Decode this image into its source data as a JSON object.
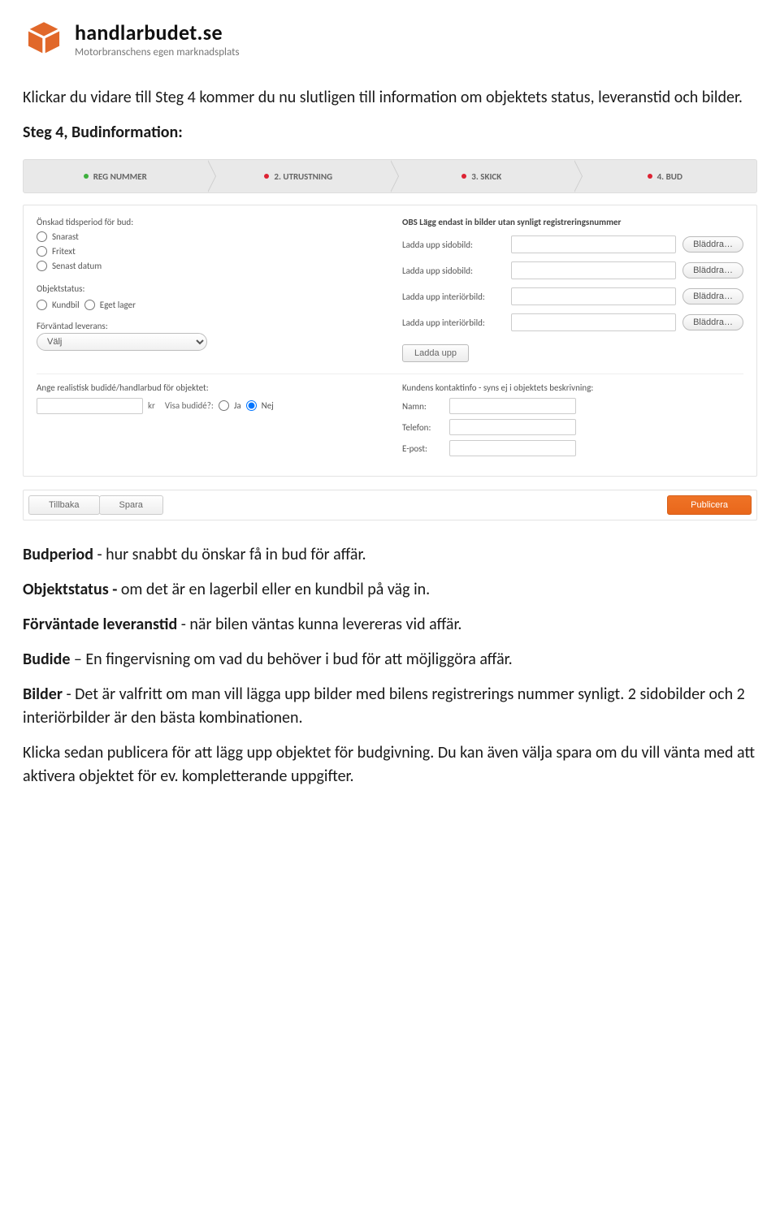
{
  "brand": {
    "title": "handlarbudet.se",
    "subtitle": "Motorbranschens egen marknadsplats"
  },
  "intro": {
    "p1": "Klickar du vidare till Steg 4 kommer du nu slutligen till information om objektets status, leveranstid och bilder.",
    "heading": "Steg 4, Budinformation:"
  },
  "stepper": {
    "s1": "REG NUMMER",
    "s2": "2. UTRUSTNING",
    "s3": "3. SKICK",
    "s4": "4. BUD"
  },
  "form": {
    "period_label": "Önskad tidsperiod för bud:",
    "period_options": {
      "snarast": "Snarast",
      "fritext": "Fritext",
      "senast": "Senast datum"
    },
    "status_label": "Objektstatus:",
    "status_options": {
      "kundbil": "Kundbil",
      "eget": "Eget lager"
    },
    "expected_label": "Förväntad leverans:",
    "expected_value": "Välj",
    "bidide_label": "Ange realistisk budidé/handlarbud för objektet:",
    "kr": "kr",
    "show_label": "Visa budidé?:",
    "yes": "Ja",
    "no": "Nej",
    "upload_notice": "OBS Lägg endast in bilder utan synligt registreringsnummer",
    "upload_side": "Ladda upp sidobild:",
    "upload_interior": "Ladda upp interiörbild:",
    "browse": "Bläddra…",
    "upload_btn": "Ladda upp",
    "contact_header": "Kundens kontaktinfo - syns ej i objektets beskrivning:",
    "contact_name": "Namn:",
    "contact_phone": "Telefon:",
    "contact_email": "E-post:"
  },
  "footer": {
    "back": "Tillbaka",
    "save": "Spara",
    "publish": "Publicera"
  },
  "explain": {
    "l1b": "Budperiod",
    "l1": " - hur snabbt du önskar få in bud för affär.",
    "l2b": "Objektstatus - ",
    "l2": "om det är en lagerbil eller en kundbil på väg in.",
    "l3b": "Förväntade leveranstid",
    "l3": " - när bilen väntas kunna levereras vid affär.",
    "l4b": "Budide",
    "l4": " – En fingervisning om vad du behöver i bud för att möjliggöra affär.",
    "l5b": "Bilder",
    "l5": " - Det är valfritt om man vill lägga upp bilder med bilens registrerings nummer synligt. 2 sidobilder och 2 interiörbilder är den bästa kombinationen.",
    "l6": "Klicka sedan publicera för att lägg upp objektet för budgivning. Du kan även välja spara om du vill vänta med att aktivera objektet för ev. kompletterande uppgifter."
  }
}
